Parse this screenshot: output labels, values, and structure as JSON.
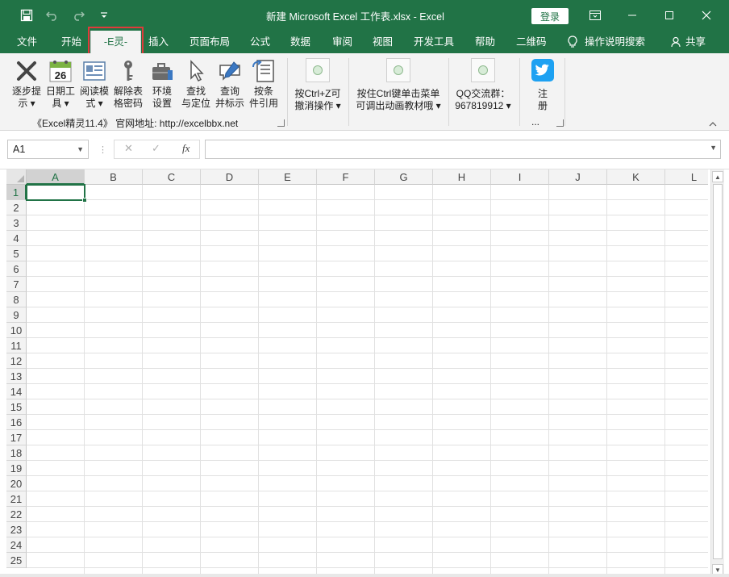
{
  "titlebar": {
    "title": "新建 Microsoft Excel 工作表.xlsx  -  Excel",
    "login_label": "登录",
    "icons": [
      "save-icon",
      "undo-icon",
      "redo-icon",
      "customize-qat-icon",
      "ribbon-display-icon",
      "minimize-icon",
      "maximize-icon",
      "close-icon"
    ]
  },
  "tabs": [
    {
      "label": "文件"
    },
    {
      "label": "开始"
    },
    {
      "label": "-E灵-",
      "active": true
    },
    {
      "label": "插入"
    },
    {
      "label": "页面布局"
    },
    {
      "label": "公式"
    },
    {
      "label": "数据"
    },
    {
      "label": "审阅"
    },
    {
      "label": "视图"
    },
    {
      "label": "开发工具"
    },
    {
      "label": "帮助"
    },
    {
      "label": "二维码"
    }
  ],
  "tellme": {
    "label": "操作说明搜索",
    "icon": "lightbulb-icon"
  },
  "share": {
    "label": "共享",
    "icon": "person-icon"
  },
  "ribbon": {
    "buttons": [
      {
        "line1": "逐步提",
        "line2": "示 ▾",
        "icon": "x-mark-icon"
      },
      {
        "line1": "日期工",
        "line2": "具 ▾",
        "icon": "calendar-icon",
        "badge": "26"
      },
      {
        "line1": "阅读模",
        "line2": "式 ▾",
        "icon": "reading-card-icon"
      },
      {
        "line1": "解除表",
        "line2": "格密码",
        "icon": "key-icon"
      },
      {
        "line1": "环境",
        "line2": "设置",
        "icon": "toolbox-icon"
      },
      {
        "line1": "查找",
        "line2": "与定位",
        "icon": "cursor-icon"
      },
      {
        "line1": "查询",
        "line2": "并标示",
        "icon": "pen-comment-icon"
      },
      {
        "line1": "按条",
        "line2": "件引用",
        "icon": "document-list-icon"
      }
    ],
    "group_label": "《Excel精灵11.4》 官网地址: http://excelbbx.net",
    "large_buttons": [
      {
        "line1": "按Ctrl+Z可",
        "line2": "撤消操作 ▾"
      },
      {
        "line1": "按住Ctrl键单击菜单",
        "line2": "可调出动画教材哦 ▾"
      },
      {
        "line1": "QQ交流群：",
        "line2": "967819912 ▾"
      }
    ],
    "register": {
      "line1": "注",
      "line2": "册",
      "icon": "twitter-bird-icon"
    },
    "ellipsis": "..."
  },
  "formula_bar": {
    "name_box": "A1",
    "cancel_glyph": "✕",
    "enter_glyph": "✓",
    "fx_label": "fx",
    "formula": ""
  },
  "grid": {
    "columns": [
      "A",
      "B",
      "C",
      "D",
      "E",
      "F",
      "G",
      "H",
      "I",
      "J",
      "K",
      "L"
    ],
    "rows": [
      "1",
      "2",
      "3",
      "4",
      "5",
      "6",
      "7",
      "8",
      "9",
      "10",
      "11",
      "12",
      "13",
      "14",
      "15",
      "16",
      "17",
      "18",
      "19",
      "20",
      "21",
      "22",
      "23",
      "24",
      "25"
    ],
    "selected_cell": "A1"
  }
}
